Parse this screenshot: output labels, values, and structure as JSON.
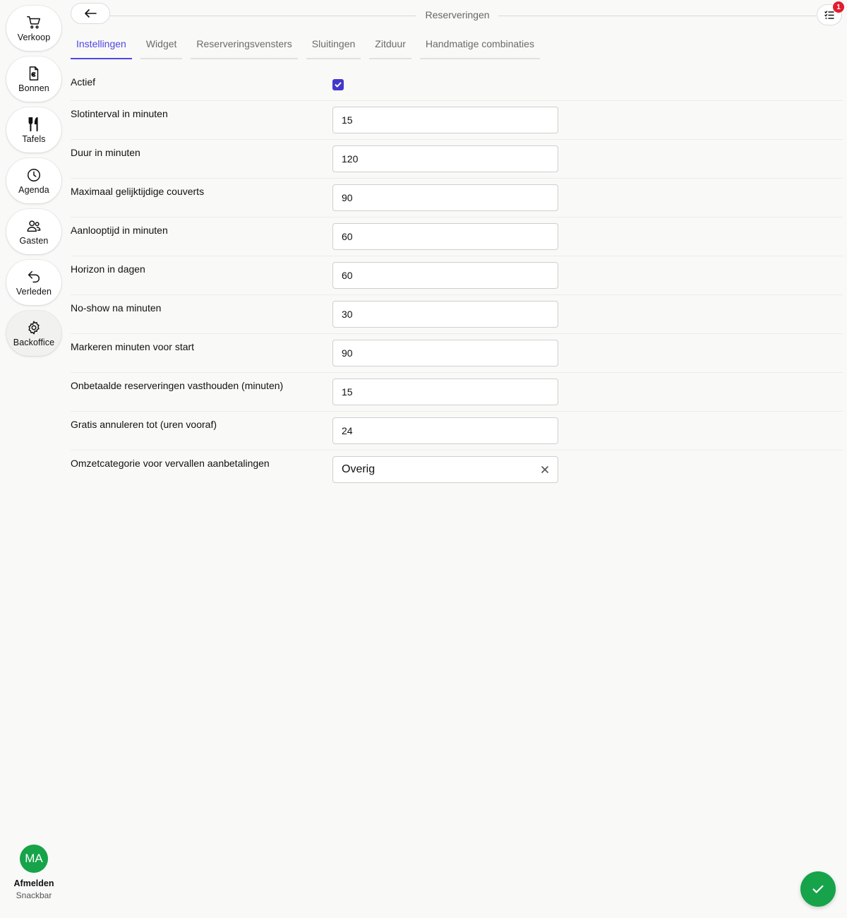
{
  "sidebar": {
    "items": [
      {
        "label": "Verkoop",
        "icon": "cart-icon"
      },
      {
        "label": "Bonnen",
        "icon": "receipt-icon"
      },
      {
        "label": "Tafels",
        "icon": "cutlery-icon"
      },
      {
        "label": "Agenda",
        "icon": "clock-icon"
      },
      {
        "label": "Gasten",
        "icon": "users-icon"
      },
      {
        "label": "Verleden",
        "icon": "undo-icon"
      },
      {
        "label": "Backoffice",
        "icon": "gear-icon",
        "active": true
      }
    ],
    "user": {
      "initials": "MA",
      "logout_label": "Afmelden",
      "location": "Snackbar"
    }
  },
  "header": {
    "title": "Reserveringen",
    "notification_count": "1"
  },
  "tabs": [
    {
      "label": "Instellingen",
      "active": true
    },
    {
      "label": "Widget"
    },
    {
      "label": "Reserveringsvensters"
    },
    {
      "label": "Sluitingen"
    },
    {
      "label": "Zitduur"
    },
    {
      "label": "Handmatige combinaties"
    }
  ],
  "form": {
    "actief": {
      "label": "Actief",
      "checked": true
    },
    "fields": [
      {
        "label": "Slotinterval in minuten",
        "value": "15"
      },
      {
        "label": "Duur in minuten",
        "value": "120"
      },
      {
        "label": "Maximaal gelijktijdige couverts",
        "value": "90"
      },
      {
        "label": "Aanlooptijd in minuten",
        "value": "60"
      },
      {
        "label": "Horizon in dagen",
        "value": "60"
      },
      {
        "label": "No-show na minuten",
        "value": "30"
      },
      {
        "label": "Markeren minuten voor start",
        "value": "90"
      },
      {
        "label": "Onbetaalde reserveringen vasthouden (minuten)",
        "value": "15"
      },
      {
        "label": "Gratis annuleren tot (uren vooraf)",
        "value": "24"
      }
    ],
    "omzetcategorie": {
      "label": "Omzetcategorie voor vervallen aanbetalingen",
      "value": "Overig"
    }
  },
  "colors": {
    "accent": "#4f46e5",
    "success": "#16a34a",
    "badge": "#e11d2e"
  }
}
